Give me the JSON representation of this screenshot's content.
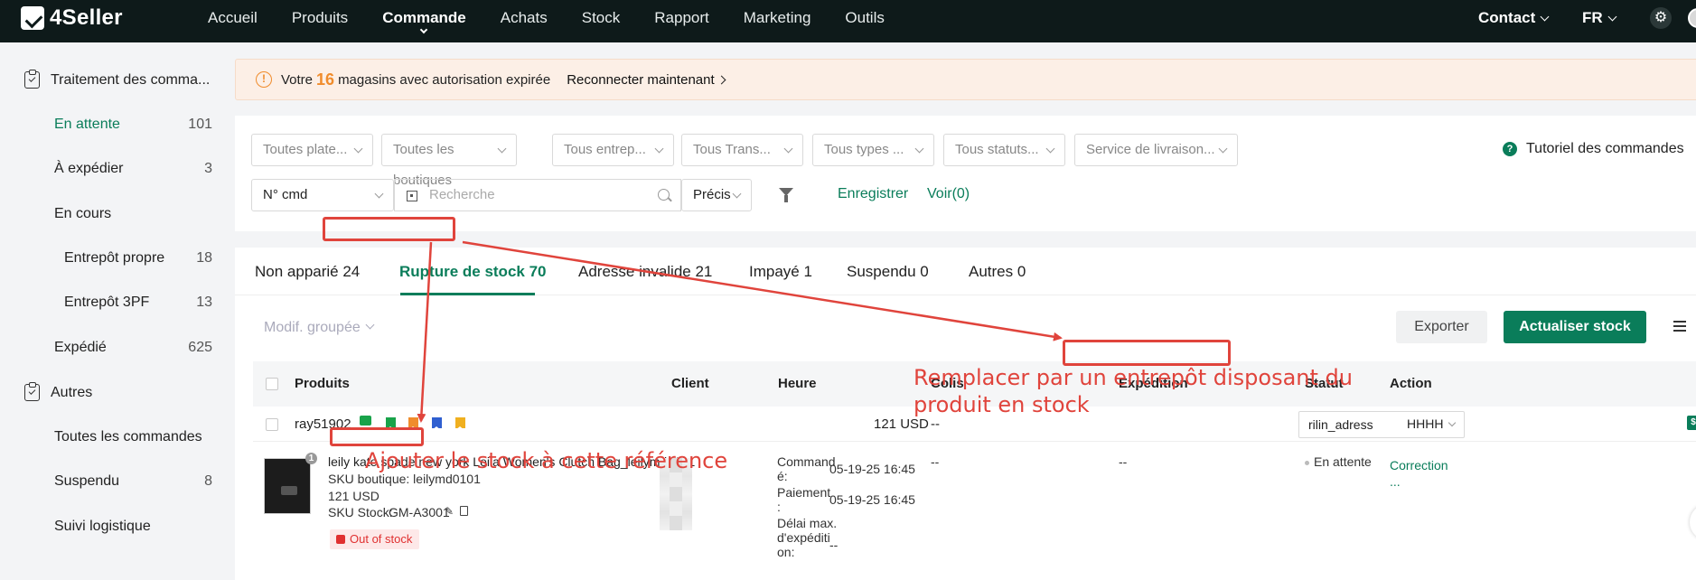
{
  "brand": {
    "name": "4Seller"
  },
  "nav": {
    "items": [
      "Accueil",
      "Produits",
      "Commande",
      "Achats",
      "Stock",
      "Rapport",
      "Marketing",
      "Outils"
    ],
    "active": "Commande",
    "contact": "Contact",
    "lang": "FR"
  },
  "sidebar": {
    "section1": "Traitement des comma...",
    "items": [
      {
        "label": "En attente",
        "count": "101"
      },
      {
        "label": "À expédier",
        "count": "3"
      },
      {
        "label": "En cours",
        "count": ""
      },
      {
        "label": "Entrepôt propre",
        "count": "18"
      },
      {
        "label": "Entrepôt 3PF",
        "count": "13"
      },
      {
        "label": "Expédié",
        "count": "625"
      }
    ],
    "section2": "Autres",
    "others": [
      {
        "label": "Toutes les commandes",
        "count": ""
      },
      {
        "label": "Suspendu",
        "count": "8"
      },
      {
        "label": "Suivi logistique",
        "count": ""
      }
    ]
  },
  "alert": {
    "prefix": "Votre",
    "count": "16",
    "suffix": "magasins avec autorisation expirée",
    "link": "Reconnecter maintenant"
  },
  "filters": {
    "selects": [
      "Toutes plate...",
      "Toutes les boutiques",
      "Tous entrep...",
      "Tous Trans...",
      "Tous types ...",
      "Tous statuts...",
      "Service de livraison..."
    ],
    "tutorial": "Tutoriel des commandes",
    "order_type": "N° cmd",
    "search_placeholder": "Recherche",
    "match": "Précis",
    "save": "Enregistrer",
    "view": "Voir(0)"
  },
  "tabs": [
    "Non apparié 24",
    "Rupture de stock 70",
    "Adresse invalide 21",
    "Impayé 1",
    "Suspendu 0",
    "Autres 0"
  ],
  "toolbar": {
    "bulk": "Modif. groupée",
    "export": "Exporter",
    "update": "Actualiser stock"
  },
  "table": {
    "headers": [
      "Produits",
      "Client",
      "Heure",
      "Colis",
      "Expédition",
      "Statut",
      "Action"
    ],
    "order": {
      "id": "ray51902",
      "amount": "121 USD",
      "colis": "--",
      "shipping": "rilin_adress",
      "action": "HHHH"
    },
    "detail": {
      "badge": "1",
      "title": "leily kate spade new york Leila Women's Clutch Bag_leilymd0101",
      "sku_shop": "SKU boutique: leilymd0101",
      "price": "121 USD",
      "sku_stock_label": "SKU Stock:",
      "sku_stock": "GM-A3001",
      "stock_status": "Out of stock",
      "time_label1": "Command\né:",
      "time_value1": "05-19-25 16:45",
      "time_label2": "Paiement\n:",
      "time_value2": "05-19-25 16:45",
      "time_label3": "Délai max.\nd'expéditi\non:",
      "time_value3": "--",
      "colis": "--",
      "shipping": "--",
      "status": "En attente",
      "action": "Correction\n..."
    }
  },
  "annotations": {
    "replace": "Remplacer par un entrepôt disposant du\nproduit en stock",
    "add_stock": "Ajouter le stock à cette référence"
  },
  "colors": {
    "accent": "#0a7d5a",
    "annotation": "#e0443c",
    "warning": "#f08c2c"
  }
}
